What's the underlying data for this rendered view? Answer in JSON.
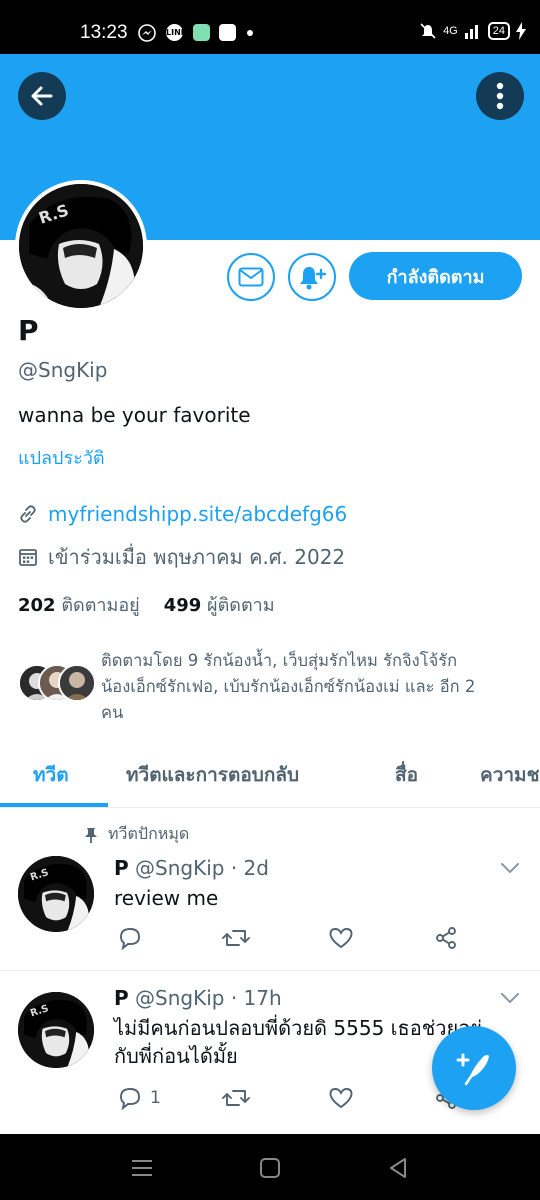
{
  "status_bar": {
    "time": "13:23",
    "network": "4G",
    "battery": "24"
  },
  "header": {
    "back_icon": "arrow-left-icon",
    "more_icon": "more-vertical-icon"
  },
  "profile": {
    "name": "P",
    "handle": "@SngKip",
    "bio": "wanna be your favorite",
    "translate_bio": "แปลประวัติ",
    "link": "myfriendshipp.site/abcdefg66",
    "joined": "เข้าร่วมเมื่อ พฤษภาคม ค.ศ. 2022",
    "following_count": "202",
    "following_label": "ติดตามอยู่",
    "followers_count": "499",
    "followers_label": "ผู้ติดตาม",
    "followed_by_line1": "ติดตามโดย 9 รักน้องน้ำ, เว็บสุ่มรักไหม รักจิงโจ้รัก",
    "followed_by_line2": "น้องเอ็กซ์รักเฟอ, เบ้บรักน้องเอ็กซ์รักน้องเม่ และ อีก 2",
    "followed_by_line3": "คน"
  },
  "actions": {
    "following_button": "กำลังติดตาม",
    "message_icon": "mail-icon",
    "notify_icon": "bell-plus-icon"
  },
  "tabs": [
    {
      "label": "ทวีต",
      "active": true
    },
    {
      "label": "ทวีตและการตอบกลับ",
      "active": false
    },
    {
      "label": "สื่อ",
      "active": false
    },
    {
      "label": "ความชอบ",
      "active": false
    }
  ],
  "pinned_label": "ทวีตปักหมุด",
  "tweets": [
    {
      "name": "P",
      "handle": "@SngKip",
      "time": "· 2d",
      "text_line1": "review me",
      "text_line2": "",
      "reply_count": ""
    },
    {
      "name": "P",
      "handle": "@SngKip",
      "time": "· 17h",
      "text_line1": "ไม่มีคนก่อนปลอบพี่ด้วยดิ 5555 เธอช่วยอยู่",
      "text_line2": "กับพี่ก่อนได้มั้ย",
      "reply_count": "1"
    }
  ],
  "colors": {
    "accent": "#1da1f2",
    "muted": "#536471",
    "text": "#0f1419"
  }
}
